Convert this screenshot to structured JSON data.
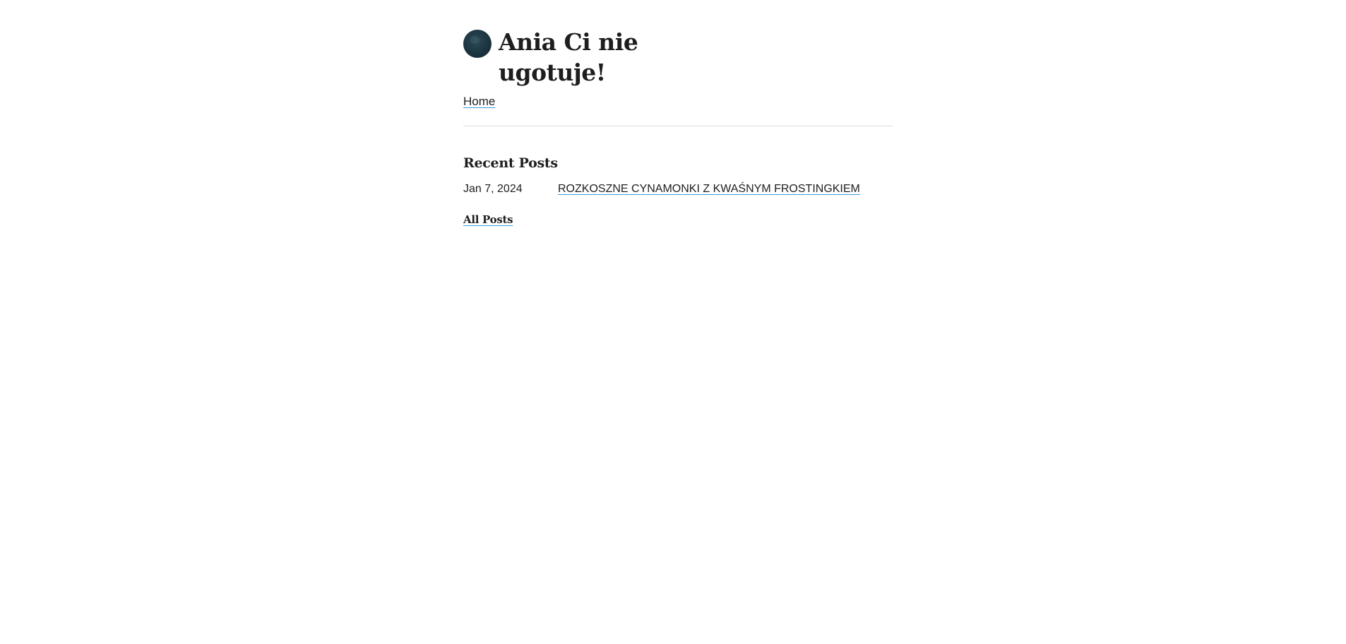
{
  "site": {
    "title": "Ania Ci nie ugotuje!",
    "logo_icon": "moon-planet-icon"
  },
  "nav": {
    "items": [
      {
        "label": "Home"
      }
    ]
  },
  "recent_posts": {
    "heading": "Recent Posts",
    "posts": [
      {
        "date": "Jan 7, 2024",
        "title": "ROZKOSZNE CYNAMONKI Z KWAŚNYM FROSTINGKIEM"
      }
    ],
    "all_posts_label": "All Posts"
  },
  "colors": {
    "link_underline": "#3a9bd5",
    "text": "#1e1e1e",
    "logo": "#1b3440"
  }
}
